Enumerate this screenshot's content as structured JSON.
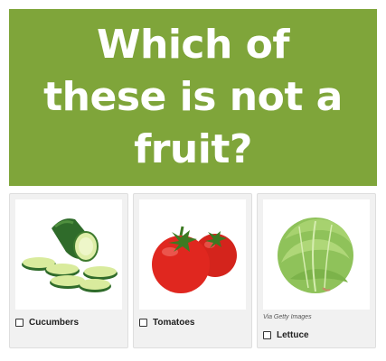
{
  "banner": {
    "title": "Which of these is not a fruit?",
    "background_color": "#7fa53a"
  },
  "options": [
    {
      "label": "Cucumbers",
      "image": "cucumber-image",
      "credit": ""
    },
    {
      "label": "Tomatoes",
      "image": "tomato-image",
      "credit": ""
    },
    {
      "label": "Lettuce",
      "image": "lettuce-image",
      "credit": "Via Getty Images"
    }
  ]
}
